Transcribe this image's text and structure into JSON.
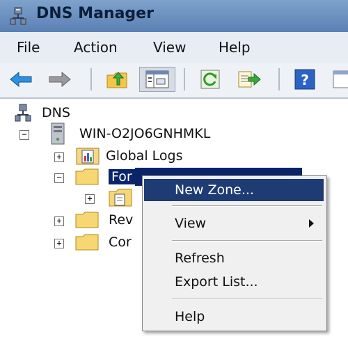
{
  "window": {
    "title": "DNS Manager"
  },
  "menu": [
    "File",
    "Action",
    "View",
    "Help"
  ],
  "toolbar": {
    "buttons": [
      "back-icon",
      "forward-icon",
      "up-folder-icon",
      "show-hide-console-tree-icon",
      "refresh-icon",
      "export-list-icon",
      "help-icon",
      "properties-icon"
    ]
  },
  "tree": {
    "root": "DNS",
    "server": "WIN-O2JO6GNHMKL",
    "items": [
      {
        "label": "Global Logs",
        "expander": "+"
      },
      {
        "label": "Forward Lookup Zones",
        "expander": "−",
        "selected": true,
        "visible_text": "For"
      },
      {
        "label": "",
        "expander": "+"
      },
      {
        "label": "Reverse Lookup Zones",
        "expander": "+",
        "visible_text": "Rev"
      },
      {
        "label": "Conditional Forwarders",
        "expander": "+",
        "visible_text": "Cor"
      }
    ]
  },
  "context_menu": {
    "items": [
      {
        "label": "New Zone...",
        "highlighted": true
      },
      {
        "label": "View",
        "submenu": true
      },
      {
        "label": "Refresh"
      },
      {
        "label": "Export List..."
      },
      {
        "label": "Help"
      }
    ]
  },
  "colors": {
    "titlebar": "#6a8fc2",
    "selection": "#0a246a",
    "menu_highlight": "#1f3b73"
  }
}
